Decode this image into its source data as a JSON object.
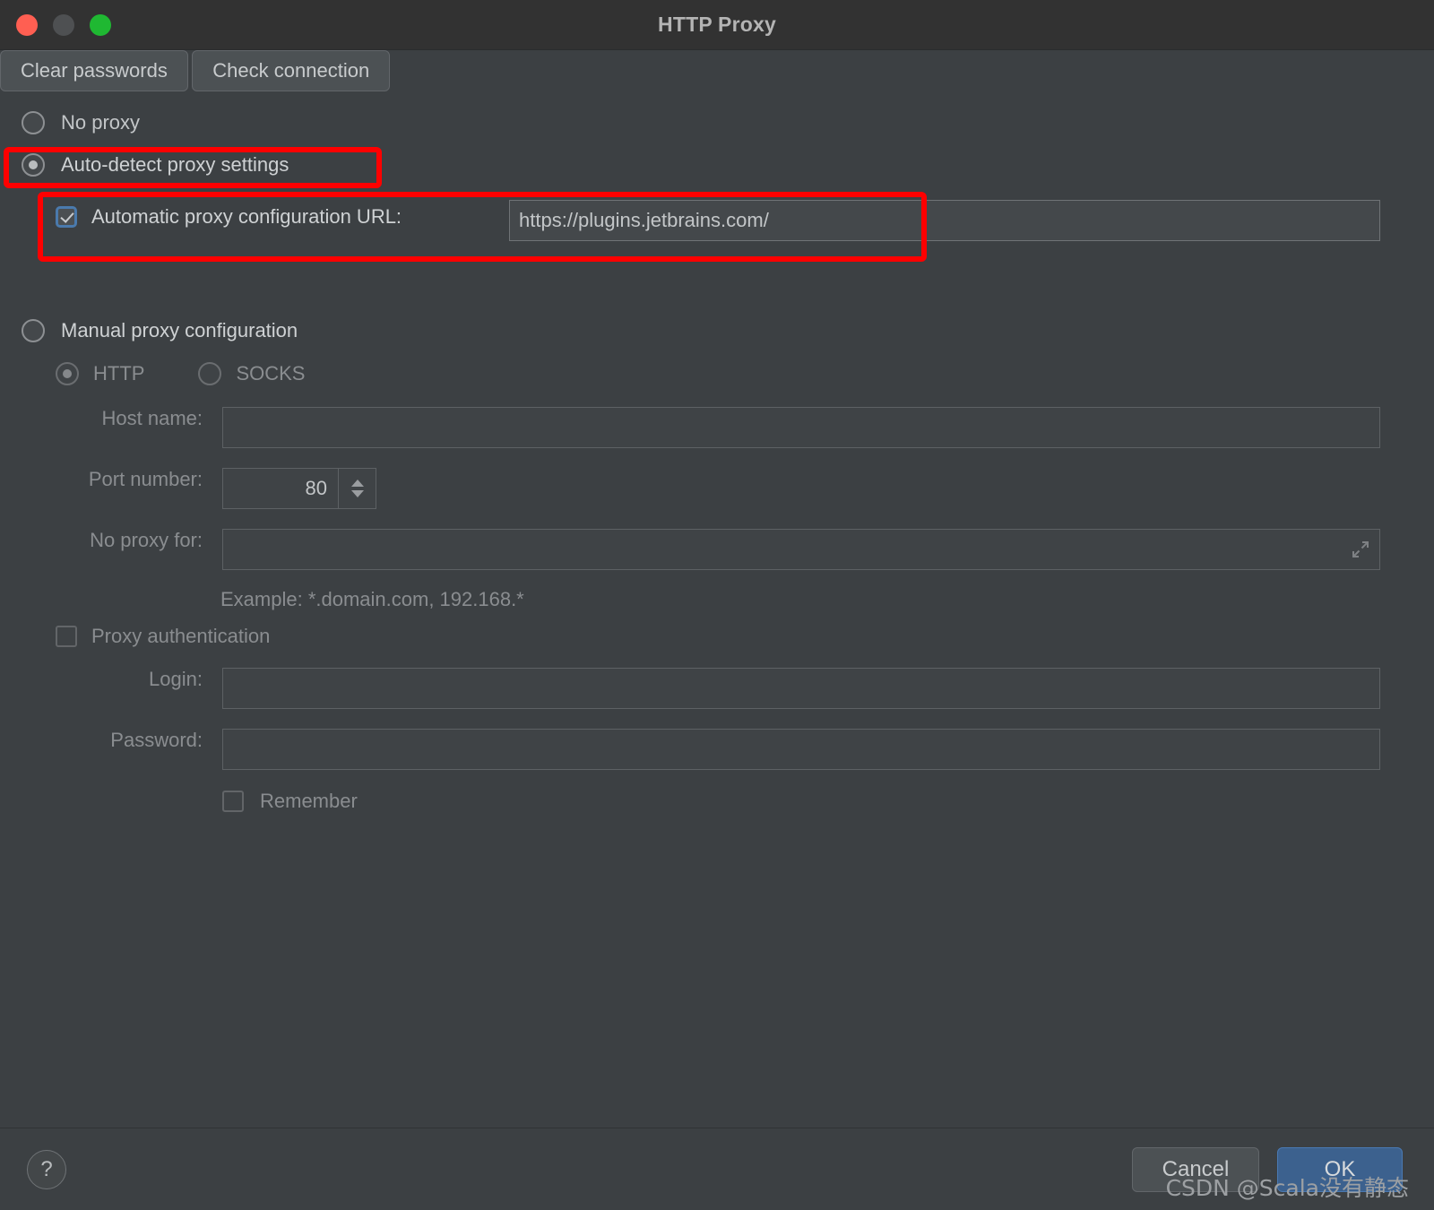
{
  "window": {
    "title": "HTTP Proxy",
    "traffic_lights": [
      "close-button",
      "minimize-button",
      "zoom-button"
    ]
  },
  "options": {
    "no_proxy": {
      "label": "No proxy",
      "selected": false
    },
    "auto_detect": {
      "label": "Auto-detect proxy settings",
      "selected": true
    },
    "manual": {
      "label": "Manual proxy configuration",
      "selected": false
    }
  },
  "pac": {
    "checkbox_label": "Automatic proxy configuration URL:",
    "checked": true,
    "url_value": "https://plugins.jetbrains.com/"
  },
  "buttons": {
    "clear_passwords": "Clear passwords",
    "check_connection": "Check connection",
    "cancel": "Cancel",
    "ok": "OK",
    "help": "?"
  },
  "manual_section": {
    "protocol": {
      "http": {
        "label": "HTTP",
        "selected": true
      },
      "socks": {
        "label": "SOCKS",
        "selected": false
      }
    },
    "host_name": {
      "label": "Host name:",
      "value": ""
    },
    "port_number": {
      "label": "Port number:",
      "value": "80"
    },
    "no_proxy_for": {
      "label": "No proxy for:",
      "value": ""
    },
    "example": "Example: *.domain.com, 192.168.*",
    "proxy_authentication": {
      "label": "Proxy authentication",
      "checked": false
    },
    "login": {
      "label": "Login:",
      "value": ""
    },
    "password": {
      "label": "Password:",
      "value": ""
    },
    "remember": {
      "label": "Remember",
      "checked": false
    }
  },
  "watermark": "CSDN @Scala没有静态",
  "colors": {
    "window_bg": "#3c4043",
    "titlebar_bg": "#323232",
    "accent_ok": "#3c618e",
    "annotation_red": "#ff0000",
    "checkbox_focus_blue": "#4a7aad"
  }
}
